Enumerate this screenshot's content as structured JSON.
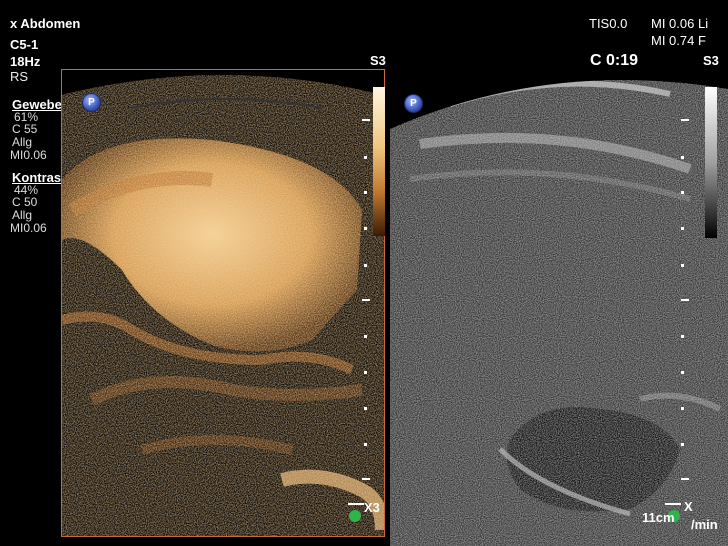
{
  "header_left": {
    "line1": "x Abdomen",
    "line2": "C5-1",
    "line3": "18Hz",
    "line4": "RS"
  },
  "gewebe": {
    "title": "Gewebe",
    "gain": "61%",
    "c": "C 55",
    "preset": "Allg",
    "mi": "MI0.06"
  },
  "kontrast": {
    "title": "Kontrast",
    "gain": "44%",
    "c": "C 50",
    "preset": "Allg",
    "mi": "MI0.06"
  },
  "header_right": {
    "tis": "TIS0.0",
    "mi_li": "MI 0.06 Li",
    "mi_f": "MI 0.74 F",
    "timer": "C 0:19",
    "s3_right": "S3"
  },
  "left_panel": {
    "s3": "S3",
    "x3": "X3",
    "badge": "P"
  },
  "right_panel": {
    "badge": "P",
    "x": "X",
    "depth": "11cm",
    "rate": "/min"
  },
  "colors": {
    "contrast_border": "#c96a3a",
    "contrast_tint": "#e0a050",
    "badge_blue": "#2b48a8",
    "indicator_green": "#2fb34a"
  }
}
